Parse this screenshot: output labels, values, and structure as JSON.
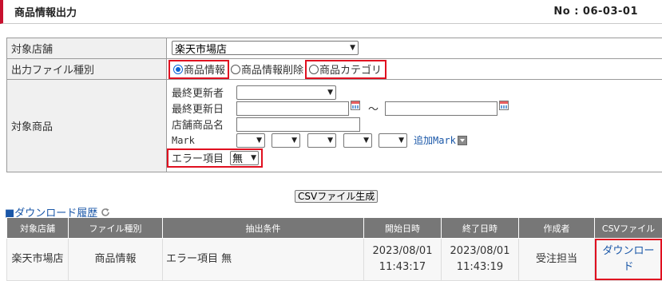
{
  "header": {
    "title": "商品情報出力",
    "doc_no": "No : 06-03-01"
  },
  "form": {
    "store": {
      "label": "対象店舗",
      "value": "楽天市場店"
    },
    "file_type": {
      "label": "出力ファイル種別",
      "options": [
        "商品情報",
        "商品情報削除",
        "商品カテゴリ"
      ],
      "selected": "商品情報"
    },
    "target": {
      "label": "対象商品",
      "last_updater_label": "最終更新者",
      "last_updated_label": "最終更新日",
      "range_sep": "～",
      "store_product_name_label": "店舗商品名",
      "mark_label": "Mark",
      "add_mark_label": "追加Mark",
      "error_item_label": "エラー項目",
      "error_item_value": "無"
    }
  },
  "generate_button": "CSVファイル生成",
  "history": {
    "link_label": "■ダウンロード履歴",
    "columns": [
      "対象店舗",
      "ファイル種別",
      "抽出条件",
      "開始日時",
      "終了日時",
      "作成者",
      "CSVファイル"
    ],
    "rows": [
      {
        "store": "楽天市場店",
        "file_type": "商品情報",
        "condition": "エラー項目 無",
        "start_date": "2023/08/01",
        "start_time": "11:43:17",
        "end_date": "2023/08/01",
        "end_time": "11:43:19",
        "creator": "受注担当",
        "csv": "ダウンロード"
      }
    ]
  },
  "colors": {
    "accent": "#c8102e",
    "highlight": "#e01020",
    "link": "#1a57a8",
    "table_header": "#777777"
  }
}
